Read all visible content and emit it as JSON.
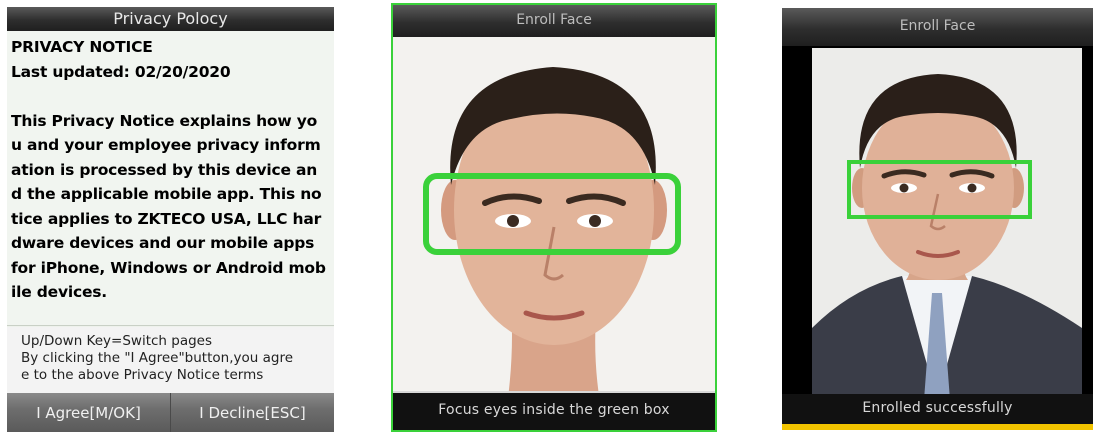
{
  "privacy_screen": {
    "title": "Privacy Polocy",
    "notice_lines": [
      "PRIVACY NOTICE",
      "Last updated: 02/20/2020",
      "",
      "This Privacy Notice explains how yo",
      "u and your employee privacy inform",
      "ation is processed by this device an",
      "d the applicable mobile app. This no",
      "tice applies to ZKTECO USA, LLC har",
      "dware devices and our mobile apps",
      "for iPhone, Windows or Android mob",
      "ile devices."
    ],
    "hint_lines": [
      "Up/Down Key=Switch pages",
      "By clicking the \"I Agree\"button,you agre",
      "e to the above Privacy Notice terms"
    ],
    "agree_button": "I Agree[M/OK]",
    "decline_button": "I Decline[ESC]"
  },
  "enroll_screen_focus": {
    "title": "Enroll Face",
    "status": "Focus eyes inside the green box"
  },
  "enroll_screen_success": {
    "title": "Enroll Face",
    "status": "Enrolled successfully"
  },
  "colors": {
    "focus_box": "#3ad13a",
    "status_accent": "#f2c400",
    "title_bar": "#2e2e2e"
  }
}
